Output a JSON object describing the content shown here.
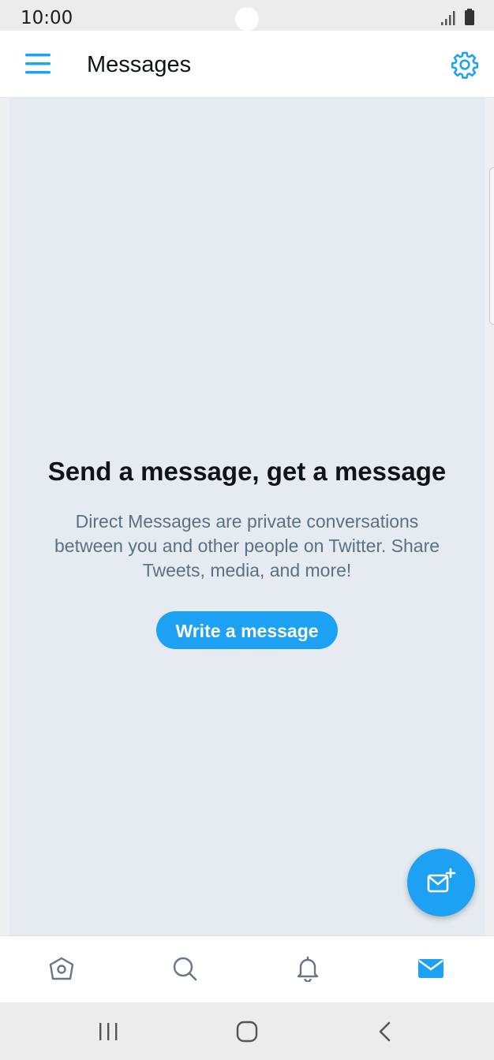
{
  "status_bar": {
    "time": "10:00",
    "icons": [
      "signal-icon",
      "battery-icon"
    ]
  },
  "header": {
    "title": "Messages",
    "menu_icon": "hamburger-menu-icon",
    "settings_icon": "gear-icon"
  },
  "empty_state": {
    "title": "Send a message, get a message",
    "description": "Direct Messages are private conversations between you and other people on Twitter. Share Tweets, media, and more!",
    "button_label": "Write a message"
  },
  "fab": {
    "icon": "new-message-icon"
  },
  "tabs": [
    {
      "name": "home",
      "icon": "home-icon",
      "active": false
    },
    {
      "name": "search",
      "icon": "search-icon",
      "active": false
    },
    {
      "name": "notifications",
      "icon": "bell-icon",
      "active": false
    },
    {
      "name": "messages",
      "icon": "envelope-icon",
      "active": true
    }
  ],
  "system_nav": [
    "recents-icon",
    "home-button-icon",
    "back-icon"
  ],
  "colors": {
    "accent": "#1da1f2",
    "title_text": "#0f1419",
    "secondary_text": "#5b7083",
    "content_background": "#e6ebf2",
    "inactive_icon": "#657786"
  }
}
